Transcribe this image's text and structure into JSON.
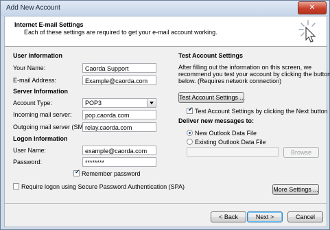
{
  "window": {
    "title": "Add New Account",
    "close_glyph": "✕"
  },
  "header": {
    "title": "Internet E-mail Settings",
    "subtitle": "Each of these settings are required to get your e-mail account working.",
    "icon": "pointer-cursor-icon"
  },
  "user_info": {
    "section": "User Information",
    "name_label": "Your Name:",
    "name_value": "Caorda Support",
    "email_label": "E-mail Address:",
    "email_value": "Example@caorda.com"
  },
  "server_info": {
    "section": "Server Information",
    "account_type_label": "Account Type:",
    "account_type_value": "POP3",
    "incoming_label": "Incoming mail server:",
    "incoming_value": "pop.caorda.com",
    "outgoing_label": "Outgoing mail server (SMTP):",
    "outgoing_value": "relay.caorda.com"
  },
  "logon_info": {
    "section": "Logon Information",
    "username_label": "User Name:",
    "username_value": "example@caorda.com",
    "password_label": "Password:",
    "password_value": "********",
    "remember_label": "Remember password",
    "remember_checked": true,
    "spa_label": "Require logon using Secure Password Authentication (SPA)",
    "spa_checked": false
  },
  "test_settings": {
    "section": "Test Account Settings",
    "description_line1": "After filling out the information on this screen, we",
    "description_line2": "recommend you test your account by clicking the button",
    "description_line3": "below. (Requires network connection)",
    "test_button": "Test Account Settings ...",
    "auto_test_label": "Test Account Settings by clicking the Next button",
    "auto_test_checked": true
  },
  "deliver": {
    "section": "Deliver new messages to:",
    "new_file_label": "New Outlook Data File",
    "existing_file_label": "Existing Outlook Data File",
    "selected": "new",
    "browse_button": "Browse",
    "existing_path": ""
  },
  "buttons": {
    "more_settings": "More Settings ...",
    "back": "< Back",
    "next": "Next >",
    "cancel": "Cancel"
  },
  "colors": {
    "accent": "#3c7fb1",
    "close": "#c9412d"
  }
}
